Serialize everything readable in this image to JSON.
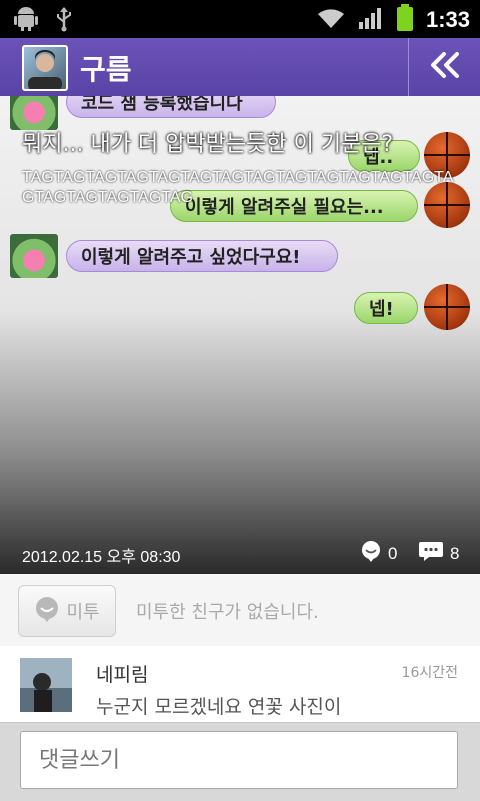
{
  "status_bar": {
    "time": "1:33"
  },
  "header": {
    "title": "구름"
  },
  "post": {
    "chat_bubbles": [
      {
        "text": "코드 잼 등록했습니다",
        "side": "left"
      },
      {
        "text": "넵..",
        "side": "right"
      },
      {
        "text": "이렇게 알려주실 필요는...",
        "side": "right"
      },
      {
        "text": "이렇게 알려주고 싶었다구요!",
        "side": "left"
      },
      {
        "text": "넵!",
        "side": "right"
      }
    ],
    "caption": "뭐지... 내가 더 압박받는듯한 이 기분은?",
    "tagline": "TAGTAGTAGTAGTAGTAGTAGTAGTAGTAGTAGTAGTAGTAGTAGTAGTAGTAGTAG",
    "date": "2012.02.15 오후 08:30",
    "metoo_count": "0",
    "comment_count": "8"
  },
  "metoo": {
    "button_label": "미투",
    "empty_text": "미투한 친구가 없습니다."
  },
  "comment": {
    "author": "네피림",
    "time": "16시간전",
    "text": "누군지 모르겠네요 연꽃 사진이"
  },
  "input": {
    "placeholder": "댓글쓰기"
  },
  "colors": {
    "header": "#5a43a6",
    "accent_green": "#9bd66a",
    "accent_purple": "#c8b3ea"
  }
}
